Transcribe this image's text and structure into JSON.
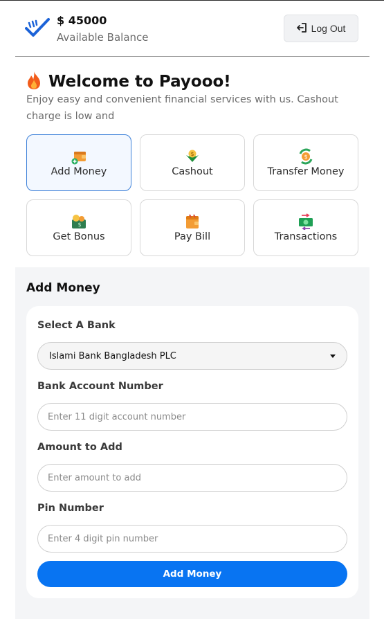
{
  "header": {
    "balance_amount": "$ 45000",
    "balance_label": "Available Balance",
    "logout_label": "Log Out",
    "logo_icon": "check-logo-icon",
    "logout_icon": "logout-arrow-icon"
  },
  "welcome": {
    "title": "Welcome to Payooo!",
    "title_icon": "fire-icon",
    "subtitle": "Enjoy easy and convenient financial services with us. Cashout charge is low and"
  },
  "services": [
    {
      "label": "Add Money",
      "icon": "wallet-add-icon",
      "active": true
    },
    {
      "label": "Cashout",
      "icon": "cashout-icon",
      "active": false
    },
    {
      "label": "Transfer Money",
      "icon": "transfer-money-icon",
      "active": false
    },
    {
      "label": "Get Bonus",
      "icon": "bonus-icon",
      "active": false
    },
    {
      "label": "Pay Bill",
      "icon": "pay-bill-icon",
      "active": false
    },
    {
      "label": "Transactions",
      "icon": "transactions-icon",
      "active": false
    }
  ],
  "form": {
    "heading": "Add Money",
    "bank_label": "Select A Bank",
    "bank_selected": "Islami Bank Bangladesh PLC",
    "account_label": "Bank Account Number",
    "account_placeholder": "Enter 11 digit account number",
    "amount_label": "Amount to Add",
    "amount_placeholder": "Enter amount to add",
    "pin_label": "Pin Number",
    "pin_placeholder": "Enter 4 digit pin number",
    "submit_label": "Add Money"
  },
  "colors": {
    "primary": "#0874f2",
    "active_tile_border": "#3b7fd8",
    "active_tile_bg": "#f3f8ff",
    "form_area_bg": "#f4f5f7"
  }
}
